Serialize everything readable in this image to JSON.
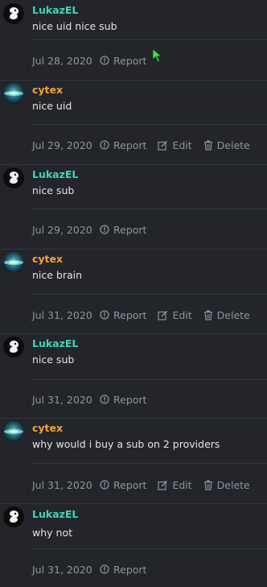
{
  "colors": {
    "background": "#23252b",
    "lukaz": "#3fd6b5",
    "cytex": "#f2a43a",
    "meta_text": "#8f949c"
  },
  "labels": {
    "report": "Report",
    "edit": "Edit",
    "delete": "Delete"
  },
  "posts": [
    {
      "author": "LukazEL",
      "message": "nice uid nice sub",
      "date": "Jul 28, 2020"
    },
    {
      "author": "cytex",
      "message": "nice uid",
      "date": "Jul 29, 2020"
    },
    {
      "author": "LukazEL",
      "message": "nice sub",
      "date": "Jul 29, 2020"
    },
    {
      "author": "cytex",
      "message": "nice brain",
      "date": "Jul 31, 2020"
    },
    {
      "author": "LukazEL",
      "message": "nice sub",
      "date": "Jul 31, 2020"
    },
    {
      "author": "cytex",
      "message": "why would i buy a sub on 2 providers",
      "date": "Jul 31, 2020"
    },
    {
      "author": "LukazEL",
      "message": "why not",
      "date": "Jul 31, 2020"
    }
  ]
}
